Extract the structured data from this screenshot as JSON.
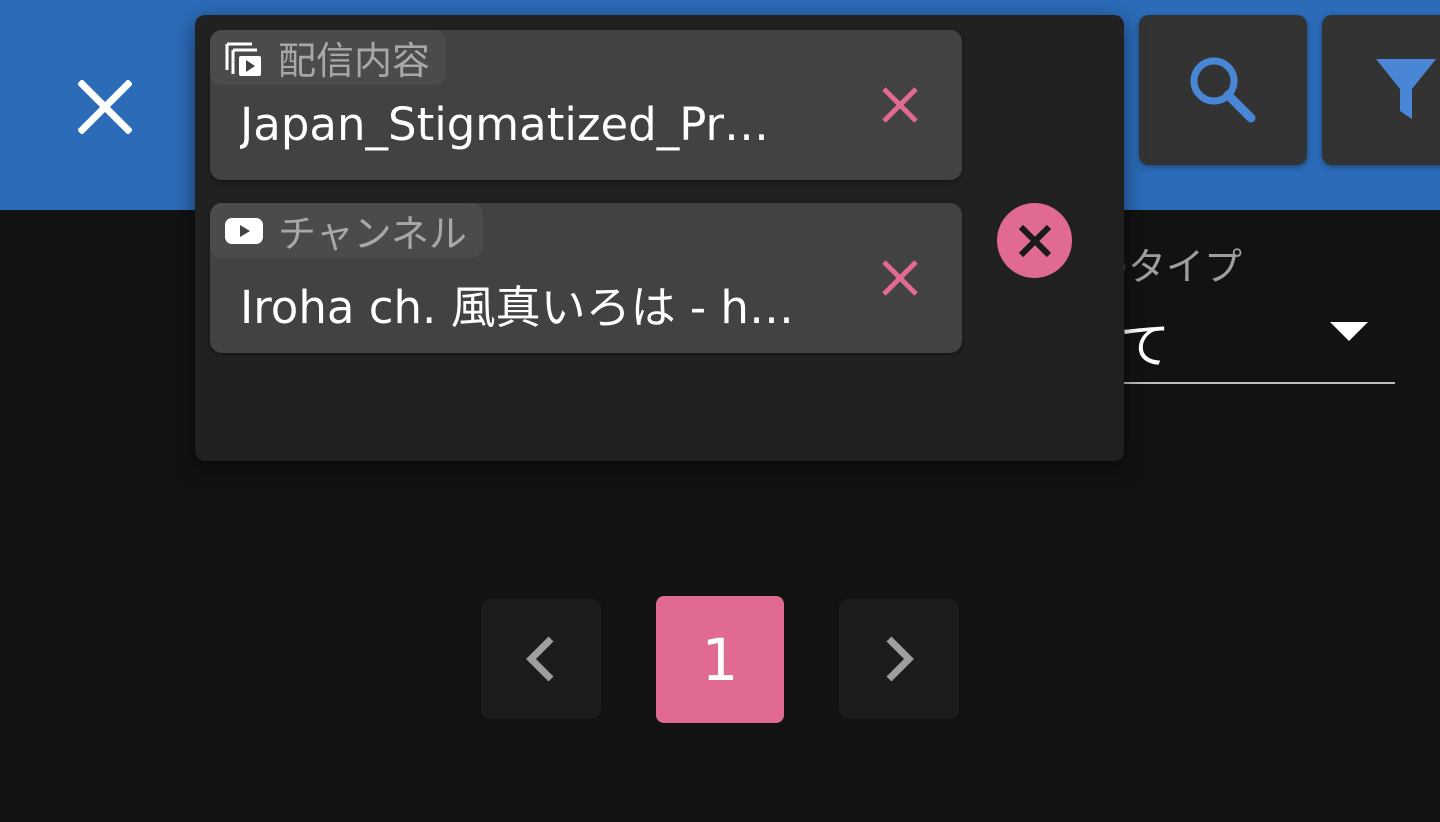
{
  "colors": {
    "appbar": "#2b6bb8",
    "background": "#121212",
    "accent_pink": "#e06a90",
    "icon_blue": "#4a86d6",
    "chip_bg": "#424242"
  },
  "header": {
    "close_icon": "close-icon",
    "search_icon": "search-icon",
    "filter_icon": "filter-icon"
  },
  "background_select": {
    "label": "のタイプ",
    "value": "て"
  },
  "filters": [
    {
      "icon": "video-library-icon",
      "label": "配信内容",
      "value": "Japan_Stigmatized_Pr…"
    },
    {
      "icon": "youtube-icon",
      "label": "チャンネル",
      "value": "Iroha ch. 風真いろは - h…"
    }
  ],
  "pagination": {
    "current_page": "1"
  }
}
